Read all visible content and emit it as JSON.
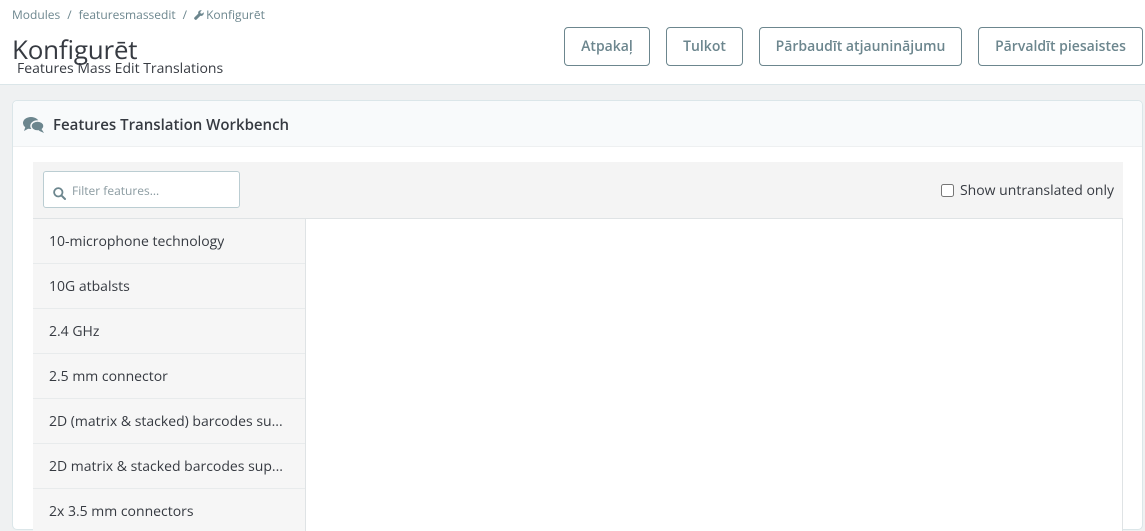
{
  "breadcrumb": {
    "items": [
      "Modules",
      "featuresmassedit",
      "Konfigurēt"
    ]
  },
  "page": {
    "title": "Konfigurēt",
    "subtitle": "Features Mass Edit Translations"
  },
  "toolbar": {
    "back_label": "Atpakaļ",
    "translate_label": "Tulkot",
    "check_update_label": "Pārbaudīt atjauninājumu",
    "manage_hooks_label": "Pārvaldīt piesaistes"
  },
  "panel": {
    "title": "Features Translation Workbench",
    "icon": "comments-icon"
  },
  "filter": {
    "placeholder": "Filter features...",
    "value": "",
    "untranslated_label": "Show untranslated only",
    "untranslated_checked": false
  },
  "features": [
    "10-microphone technology",
    "10G atbalsts",
    "2.4 GHz",
    "2.5 mm connector",
    "2D (matrix & stacked) barcodes su...",
    "2D matrix & stacked barcodes sup...",
    "2x 3.5 mm connectors"
  ],
  "colors": {
    "accent": "#6c868e",
    "text": "#363a41",
    "background": "#eff1f2"
  }
}
